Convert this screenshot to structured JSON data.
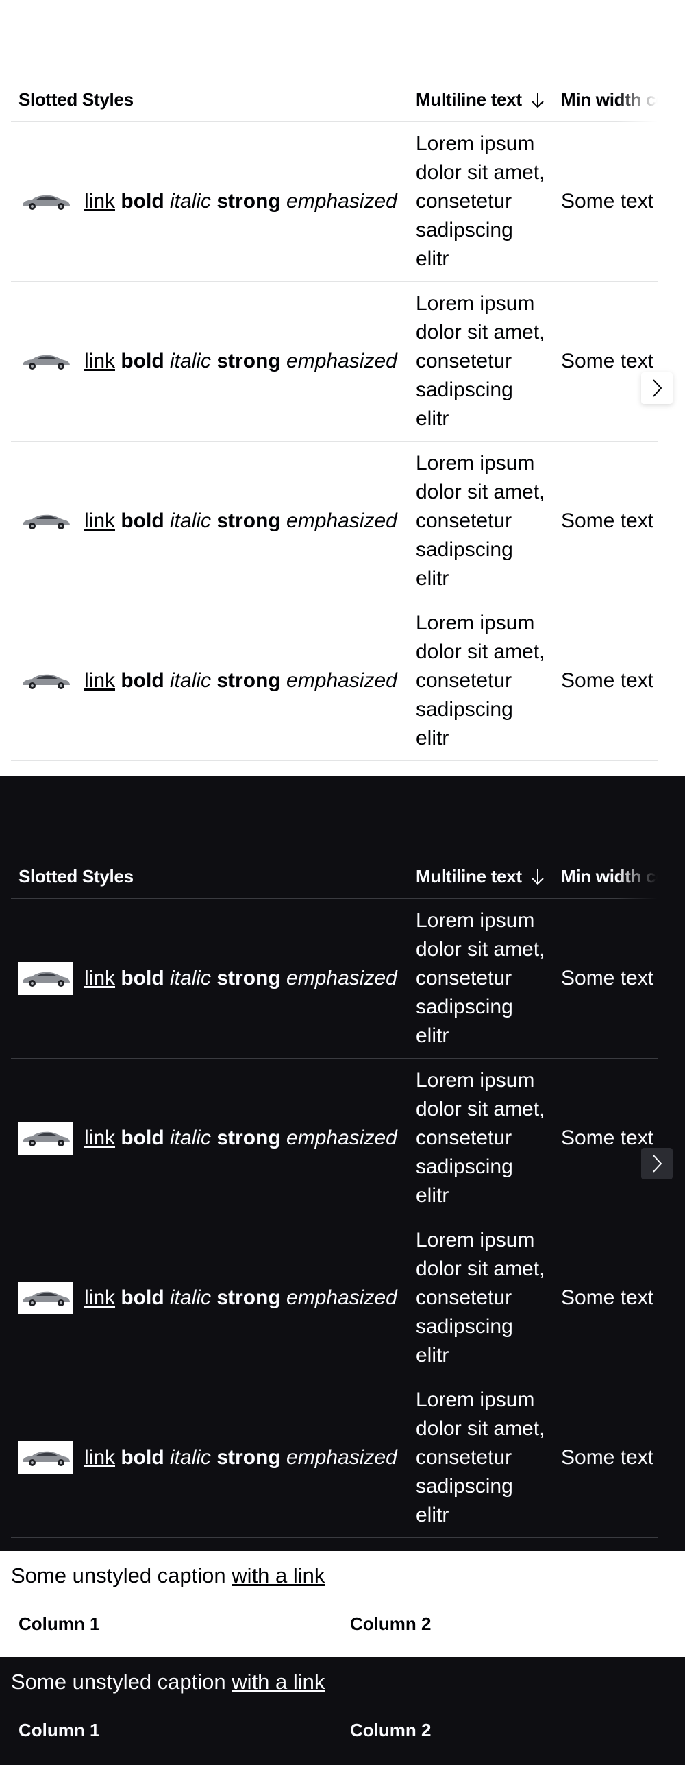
{
  "table": {
    "headers": {
      "col1": "Slotted Styles",
      "col2": "Multiline text",
      "col3": "Min width cell"
    },
    "sort_icon": "arrow-down-icon",
    "scroll_icon": "chevron-right-icon",
    "rows": [
      {
        "link": "link",
        "bold": "bold",
        "italic": "italic",
        "strong": "strong",
        "emphasized": "emphasized",
        "multiline": [
          "Lorem ipsum",
          "dolor sit amet,",
          "consetetur",
          "sadipscing",
          "elitr"
        ],
        "minwidth": "Some text"
      },
      {
        "link": "link",
        "bold": "bold",
        "italic": "italic",
        "strong": "strong",
        "emphasized": "emphasized",
        "multiline": [
          "Lorem ipsum",
          "dolor sit amet,",
          "consetetur",
          "sadipscing",
          "elitr"
        ],
        "minwidth": "Some text"
      },
      {
        "link": "link",
        "bold": "bold",
        "italic": "italic",
        "strong": "strong",
        "emphasized": "emphasized",
        "multiline": [
          "Lorem ipsum",
          "dolor sit amet,",
          "consetetur",
          "sadipscing",
          "elitr"
        ],
        "minwidth": "Some text"
      },
      {
        "link": "link",
        "bold": "bold",
        "italic": "italic",
        "strong": "strong",
        "emphasized": "emphasized",
        "multiline": [
          "Lorem ipsum",
          "dolor sit amet,",
          "consetetur",
          "sadipscing",
          "elitr"
        ],
        "minwidth": "Some text"
      }
    ]
  },
  "caption": {
    "text": "Some unstyled caption ",
    "link": "with a link",
    "col1": "Column 1",
    "col2": "Column 2"
  },
  "colors": {
    "light_bg": "#ffffff",
    "dark_bg": "#0e0e12",
    "light_text": "#010205",
    "dark_text": "#fbfcff"
  }
}
